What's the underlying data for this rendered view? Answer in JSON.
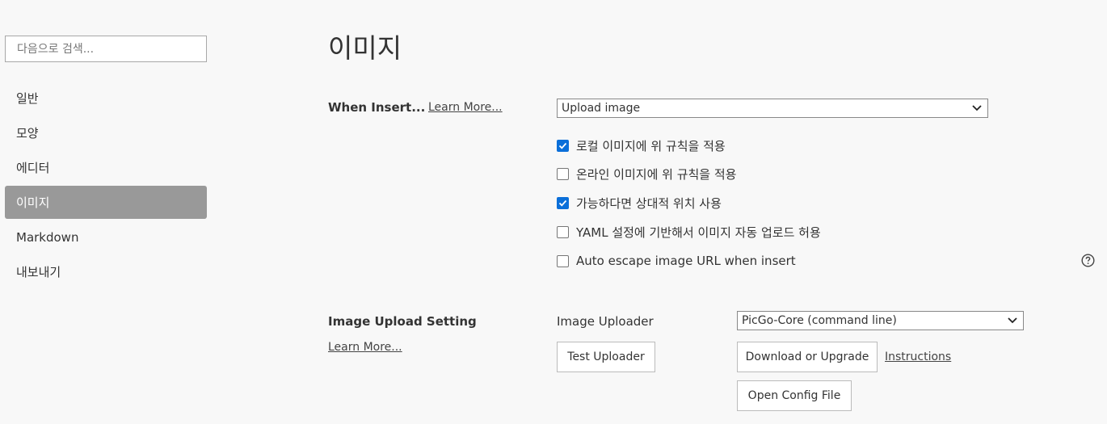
{
  "search": {
    "placeholder": "다음으로 검색..."
  },
  "sidebar": {
    "items": [
      {
        "label": "일반"
      },
      {
        "label": "모양"
      },
      {
        "label": "에디터"
      },
      {
        "label": "이미지"
      },
      {
        "label": "Markdown"
      },
      {
        "label": "내보내기"
      }
    ],
    "active_index": 3
  },
  "page": {
    "title": "이미지"
  },
  "when_insert": {
    "label": "When Insert...",
    "learn_more": "Learn More...",
    "selected": "Upload image",
    "options": [
      {
        "label": "로컬 이미지에 위 규칙을 적용",
        "checked": true
      },
      {
        "label": "온라인 이미지에 위 규칙을 적용",
        "checked": false
      },
      {
        "label": "가능하다면 상대적 위치 사용",
        "checked": true
      },
      {
        "label": "YAML 설정에 기반해서 이미지 자동 업로드 허용",
        "checked": false
      },
      {
        "label": "Auto escape image URL when insert",
        "checked": false
      }
    ]
  },
  "upload": {
    "label": "Image Upload Setting",
    "learn_more": "Learn More...",
    "uploader_label": "Image Uploader",
    "uploader_selected": "PicGo-Core (command line)",
    "test_button": "Test Uploader",
    "download_button": "Download or Upgrade",
    "instructions_link": "Instructions",
    "open_config_button": "Open Config File"
  },
  "icons": {
    "help": "help-circle-icon",
    "dropdown": "chevron-down-icon",
    "check": "checkmark-icon"
  },
  "colors": {
    "accent": "#0b6fd9",
    "active_nav": "#999999",
    "background": "#f8f8f8"
  }
}
